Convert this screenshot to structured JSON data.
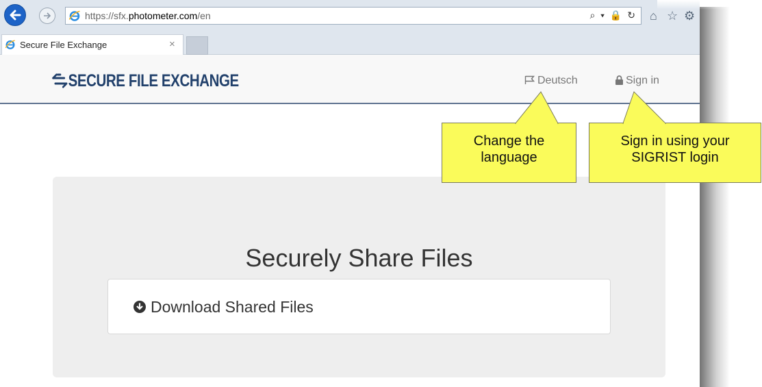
{
  "browser": {
    "url_scheme": "https://sfx.",
    "url_domain": "photometer.com",
    "url_path": "/en",
    "url_tools": "⌕ ▾ 🔒 ↻",
    "tab_title": "Secure File Exchange",
    "tab_close": "×"
  },
  "site": {
    "brand": "SECURE FILE EXCHANGE",
    "nav_language": "Deutsch",
    "nav_signin": "Sign in",
    "headline": "Securely Share Files",
    "download_label": "Download Shared Files"
  },
  "callouts": {
    "language_line1": "Change the",
    "language_line2": "language",
    "signin_line1": "Sign in using your",
    "signin_line2": "SIGRIST login"
  },
  "colors": {
    "brand": "#21406b",
    "callout_fill": "#fafb5a",
    "jumbotron": "#eeeeee",
    "ie_blue": "#1d63c7"
  }
}
